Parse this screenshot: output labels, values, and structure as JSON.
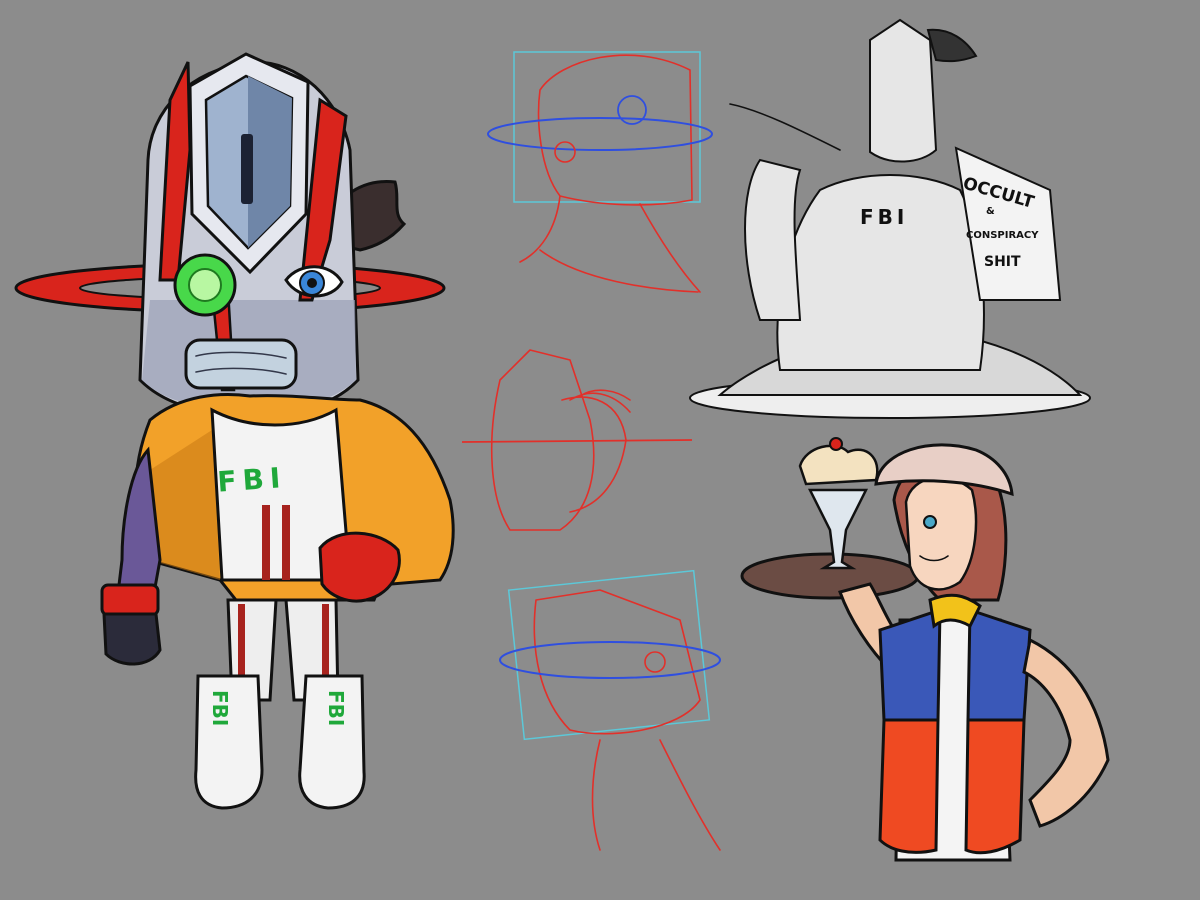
{
  "sheet": {
    "background": "#8c8c8c"
  },
  "colors": {
    "helmet_silver": "#c9ccd8",
    "helmet_blue": "#6f86a8",
    "visor_blue": "#9fb3cf",
    "accent_red": "#d9241c",
    "jacket_orange": "#f2a129",
    "lens_green": "#48d84a",
    "fbi_green": "#1fa83a",
    "sketch_red": "#e2302a",
    "sketch_blue": "#2f4fe0",
    "sketch_cyan": "#5cc8d8",
    "vest_blue": "#3a58b8",
    "vest_red": "#ef4a22",
    "vest_yellow": "#f2c21a",
    "cap_pink": "#e8cfc6",
    "hair_brown": "#a9584a",
    "tray": "#6b4c44"
  },
  "lettering": {
    "chest": "FBI",
    "left_boot": "FBI",
    "right_boot": "FBI",
    "sketch_chest": "FBI",
    "book_line1": "OCCULT",
    "book_line2": "&",
    "book_line3": "CONSPIRACY",
    "book_line4": "SHIT"
  }
}
